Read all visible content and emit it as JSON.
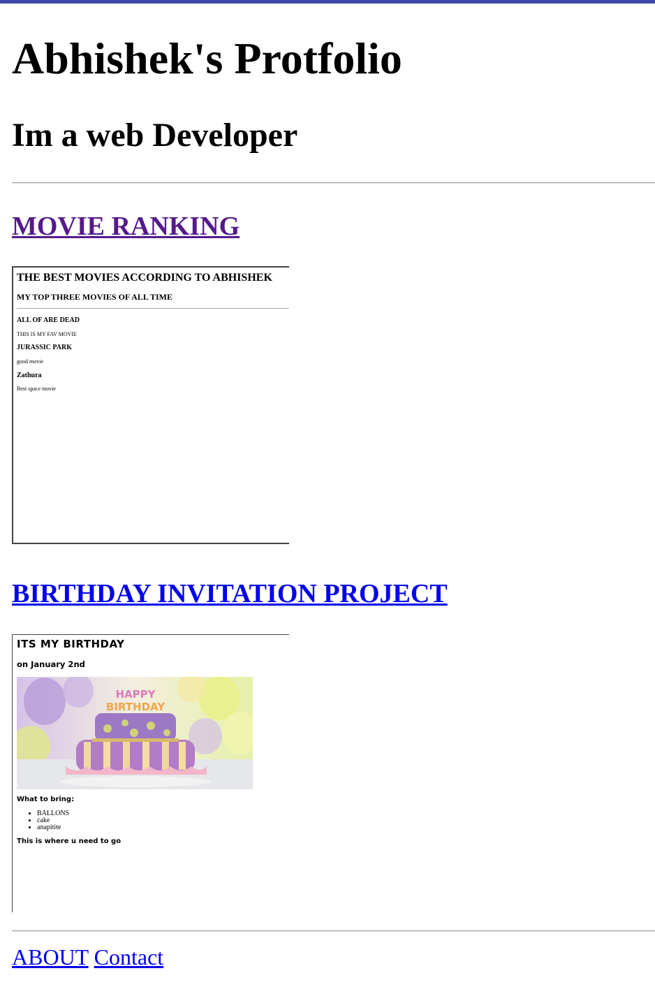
{
  "header": {
    "title": "Abhishek's Protfolio",
    "subtitle": "Im a web Developer"
  },
  "projects": [
    {
      "link_label": "MOVIE RANKING",
      "preview": {
        "heading": "THE BEST MOVIES ACCORDING TO ABHISHEK",
        "subheading": "MY TOP THREE MOVIES OF ALL TIME",
        "movies": [
          {
            "title": "ALL OF ARE DEAD",
            "description": "THIS IS MY FAV MOVIE"
          },
          {
            "title": "JURASSIC PARK",
            "description": "good movie"
          },
          {
            "title": "Zathura",
            "description": "Best space movie"
          }
        ]
      }
    },
    {
      "link_label": "BIRTHDAY INVITATION PROJECT",
      "preview": {
        "heading": "ITS MY BIRTHDAY",
        "date": "on January 2nd",
        "cake_candle_text": "HAPPY BIRTHDAY",
        "bring_heading": "What to bring:",
        "bring_items": [
          "BALLONS",
          "cake",
          "anapitite"
        ],
        "directions": "This is where u need to go"
      }
    }
  ],
  "footer": {
    "links": [
      "ABOUT",
      "Contact"
    ]
  },
  "colors": {
    "top_bar": "#3f48a6",
    "visited_link": "#551a8b",
    "link": "#0000ee"
  }
}
